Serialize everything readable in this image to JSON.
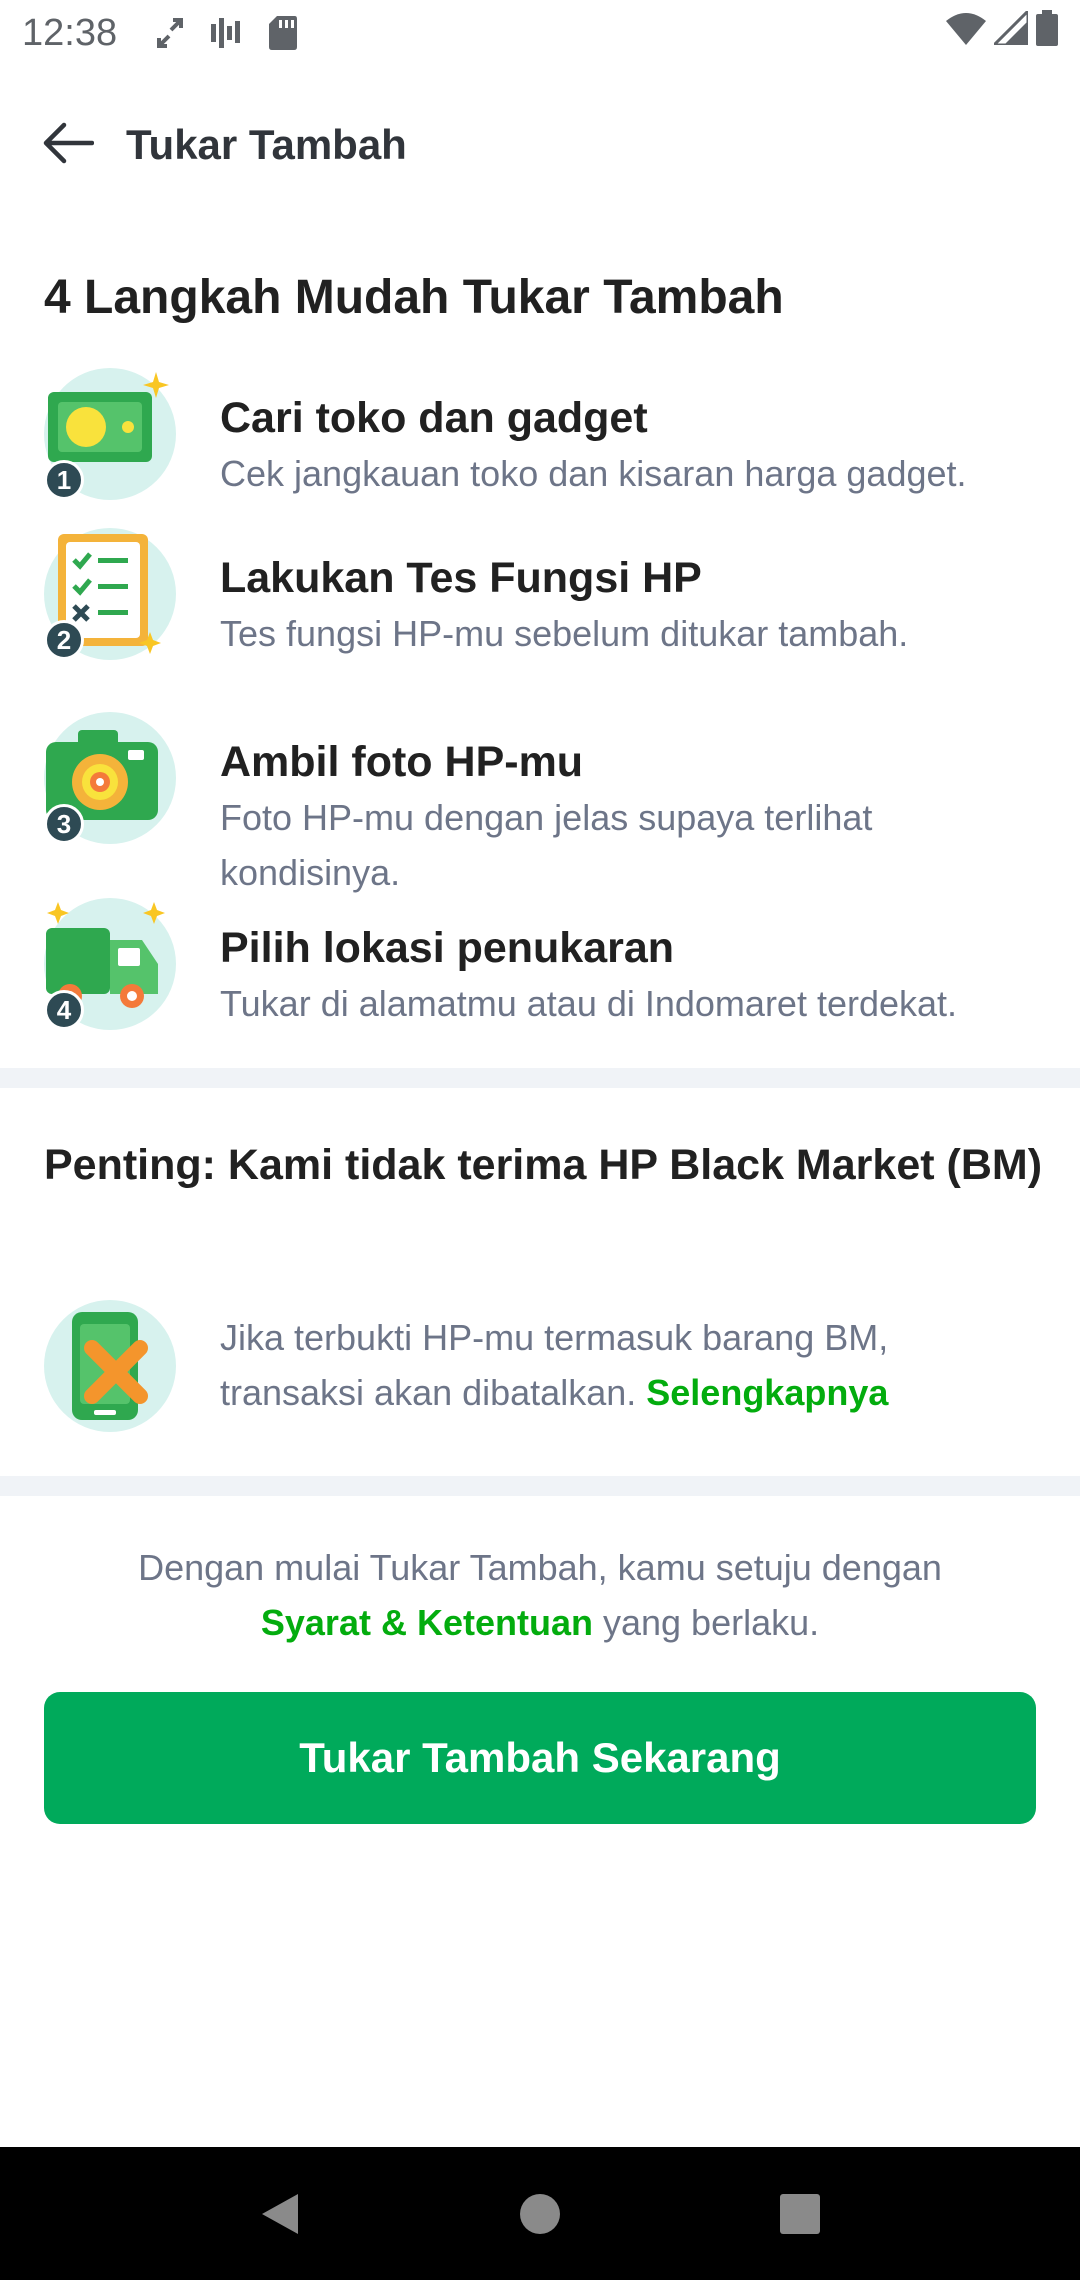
{
  "status_bar": {
    "time": "12:38",
    "icons": [
      "sync-icon",
      "sound-bars-icon",
      "sd-card-icon",
      "wifi-icon",
      "signal-icon",
      "battery-icon"
    ]
  },
  "app_bar": {
    "title": "Tukar Tambah",
    "back_icon": "arrow-left-icon"
  },
  "steps_section": {
    "title": "4 Langkah Mudah Tukar Tambah",
    "steps": [
      {
        "number": "1",
        "title": "Cari toko dan gadget",
        "desc": "Cek jangkauan toko dan kisaran harga gadget.",
        "icon": "money-icon"
      },
      {
        "number": "2",
        "title": "Lakukan Tes Fungsi HP",
        "desc": "Tes fungsi HP-mu sebelum ditukar tambah.",
        "icon": "checklist-icon"
      },
      {
        "number": "3",
        "title": "Ambil foto HP-mu",
        "desc": "Foto HP-mu dengan jelas supaya terlihat kondisinya.",
        "icon": "camera-icon"
      },
      {
        "number": "4",
        "title": "Pilih lokasi penukaran",
        "desc": "Tukar di alamatmu atau di Indomaret terdekat.",
        "icon": "delivery-truck-icon"
      }
    ]
  },
  "important": {
    "title": "Penting: Kami tidak terima HP Black Market (BM)",
    "text": "Jika terbukti HP-mu termasuk barang BM, transaksi akan dibatalkan.",
    "link": "Selengkapnya",
    "icon": "phone-cross-icon"
  },
  "agreement": {
    "prefix": "Dengan mulai Tukar Tambah, kamu setuju dengan",
    "link": "Syarat & Ketentuan",
    "suffix": "yang berlaku."
  },
  "cta": {
    "label": "Tukar Tambah Sekarang"
  },
  "nav_bar": {
    "icons": [
      "back-triangle-icon",
      "home-circle-icon",
      "recents-square-icon"
    ]
  },
  "colors": {
    "brand_green": "#00aa5b",
    "link_green": "#03ac0e",
    "text_primary": "#212121",
    "text_secondary": "#6d7588",
    "divider": "#f0f3f7"
  }
}
